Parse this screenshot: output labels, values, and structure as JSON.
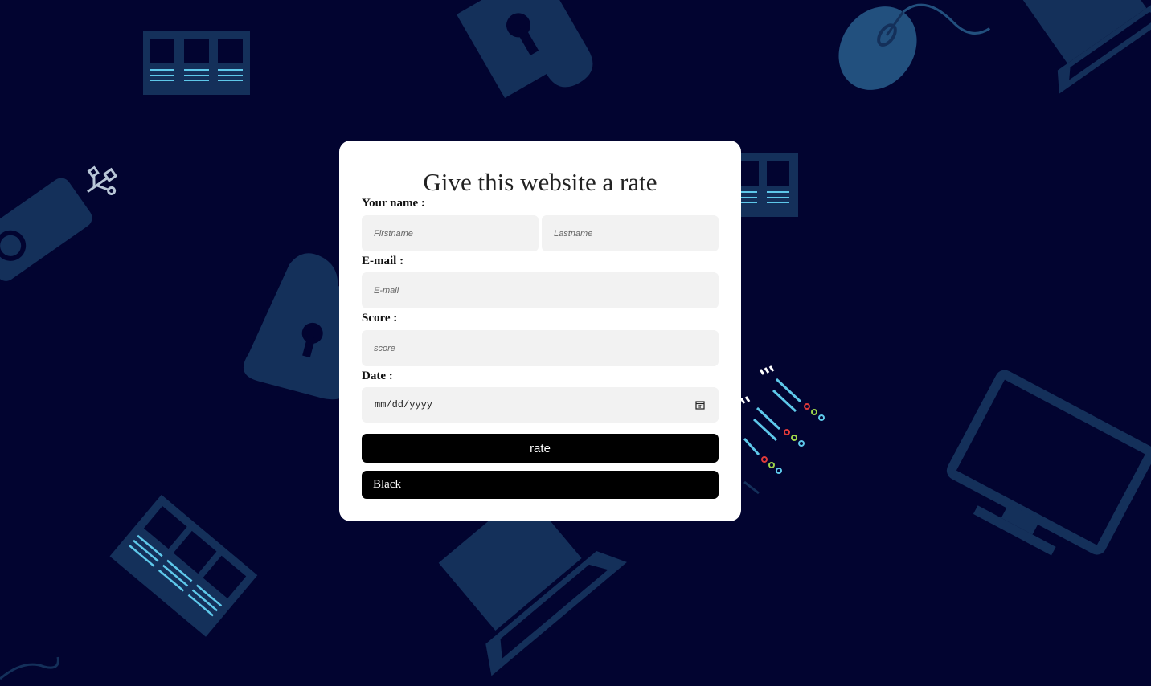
{
  "form": {
    "title": "Give this website a rate",
    "name_label": "Your name :",
    "firstname_placeholder": "Firstname",
    "lastname_placeholder": "Lastname",
    "email_label": "E-mail :",
    "email_placeholder": "E-mail",
    "score_label": "Score :",
    "score_placeholder": "score",
    "date_label": "Date :",
    "date_placeholder": "mm/dd/yyyy",
    "rate_button": "rate",
    "theme_select": "Black"
  },
  "colors": {
    "background": "#020430",
    "card": "#ffffff",
    "field": "#f2f2f2",
    "button": "#000000",
    "illustration": "#14305a",
    "illustration_light": "#1e4f82",
    "accent_cyan": "#5ec8ea"
  },
  "decor_icons": [
    "window-grid-icon",
    "cloud-lock-icon",
    "mouse-icon",
    "laptop-icon",
    "usb-drive-icon",
    "window-grid-icon",
    "cloud-lock-icon",
    "code-lines-icon",
    "monitor-icon",
    "window-grid-icon",
    "laptop-icon",
    "cable-icon"
  ]
}
